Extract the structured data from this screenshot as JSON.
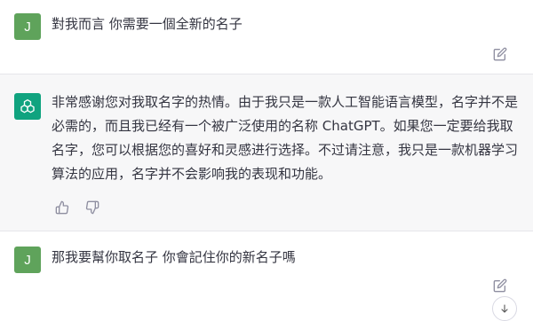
{
  "messages": [
    {
      "role": "user",
      "avatar_label": "J",
      "text": "對我而言 你需要一個全新的名子"
    },
    {
      "role": "assistant",
      "text": "非常感谢您对我取名字的热情。由于我只是一款人工智能语言模型，名字并不是必需的，而且我已经有一个被广泛使用的名称 ChatGPT。如果您一定要给我取名字，您可以根据您的喜好和灵感进行选择。不过请注意，我只是一款机器学习算法的应用，名字并不会影响我的表现和功能。"
    },
    {
      "role": "user",
      "avatar_label": "J",
      "text": "那我要幫你取名子 你會記住你的新名子嗎"
    }
  ],
  "icons": {
    "edit": "edit-icon",
    "thumb_up": "thumbs-up-icon",
    "thumb_down": "thumbs-down-icon",
    "scroll_down": "arrow-down-icon",
    "assistant_avatar": "openai-logo-icon"
  },
  "colors": {
    "user_avatar": "#5fa35b",
    "assistant_avatar": "#10a37f",
    "assistant_bg": "#f7f7f8"
  }
}
